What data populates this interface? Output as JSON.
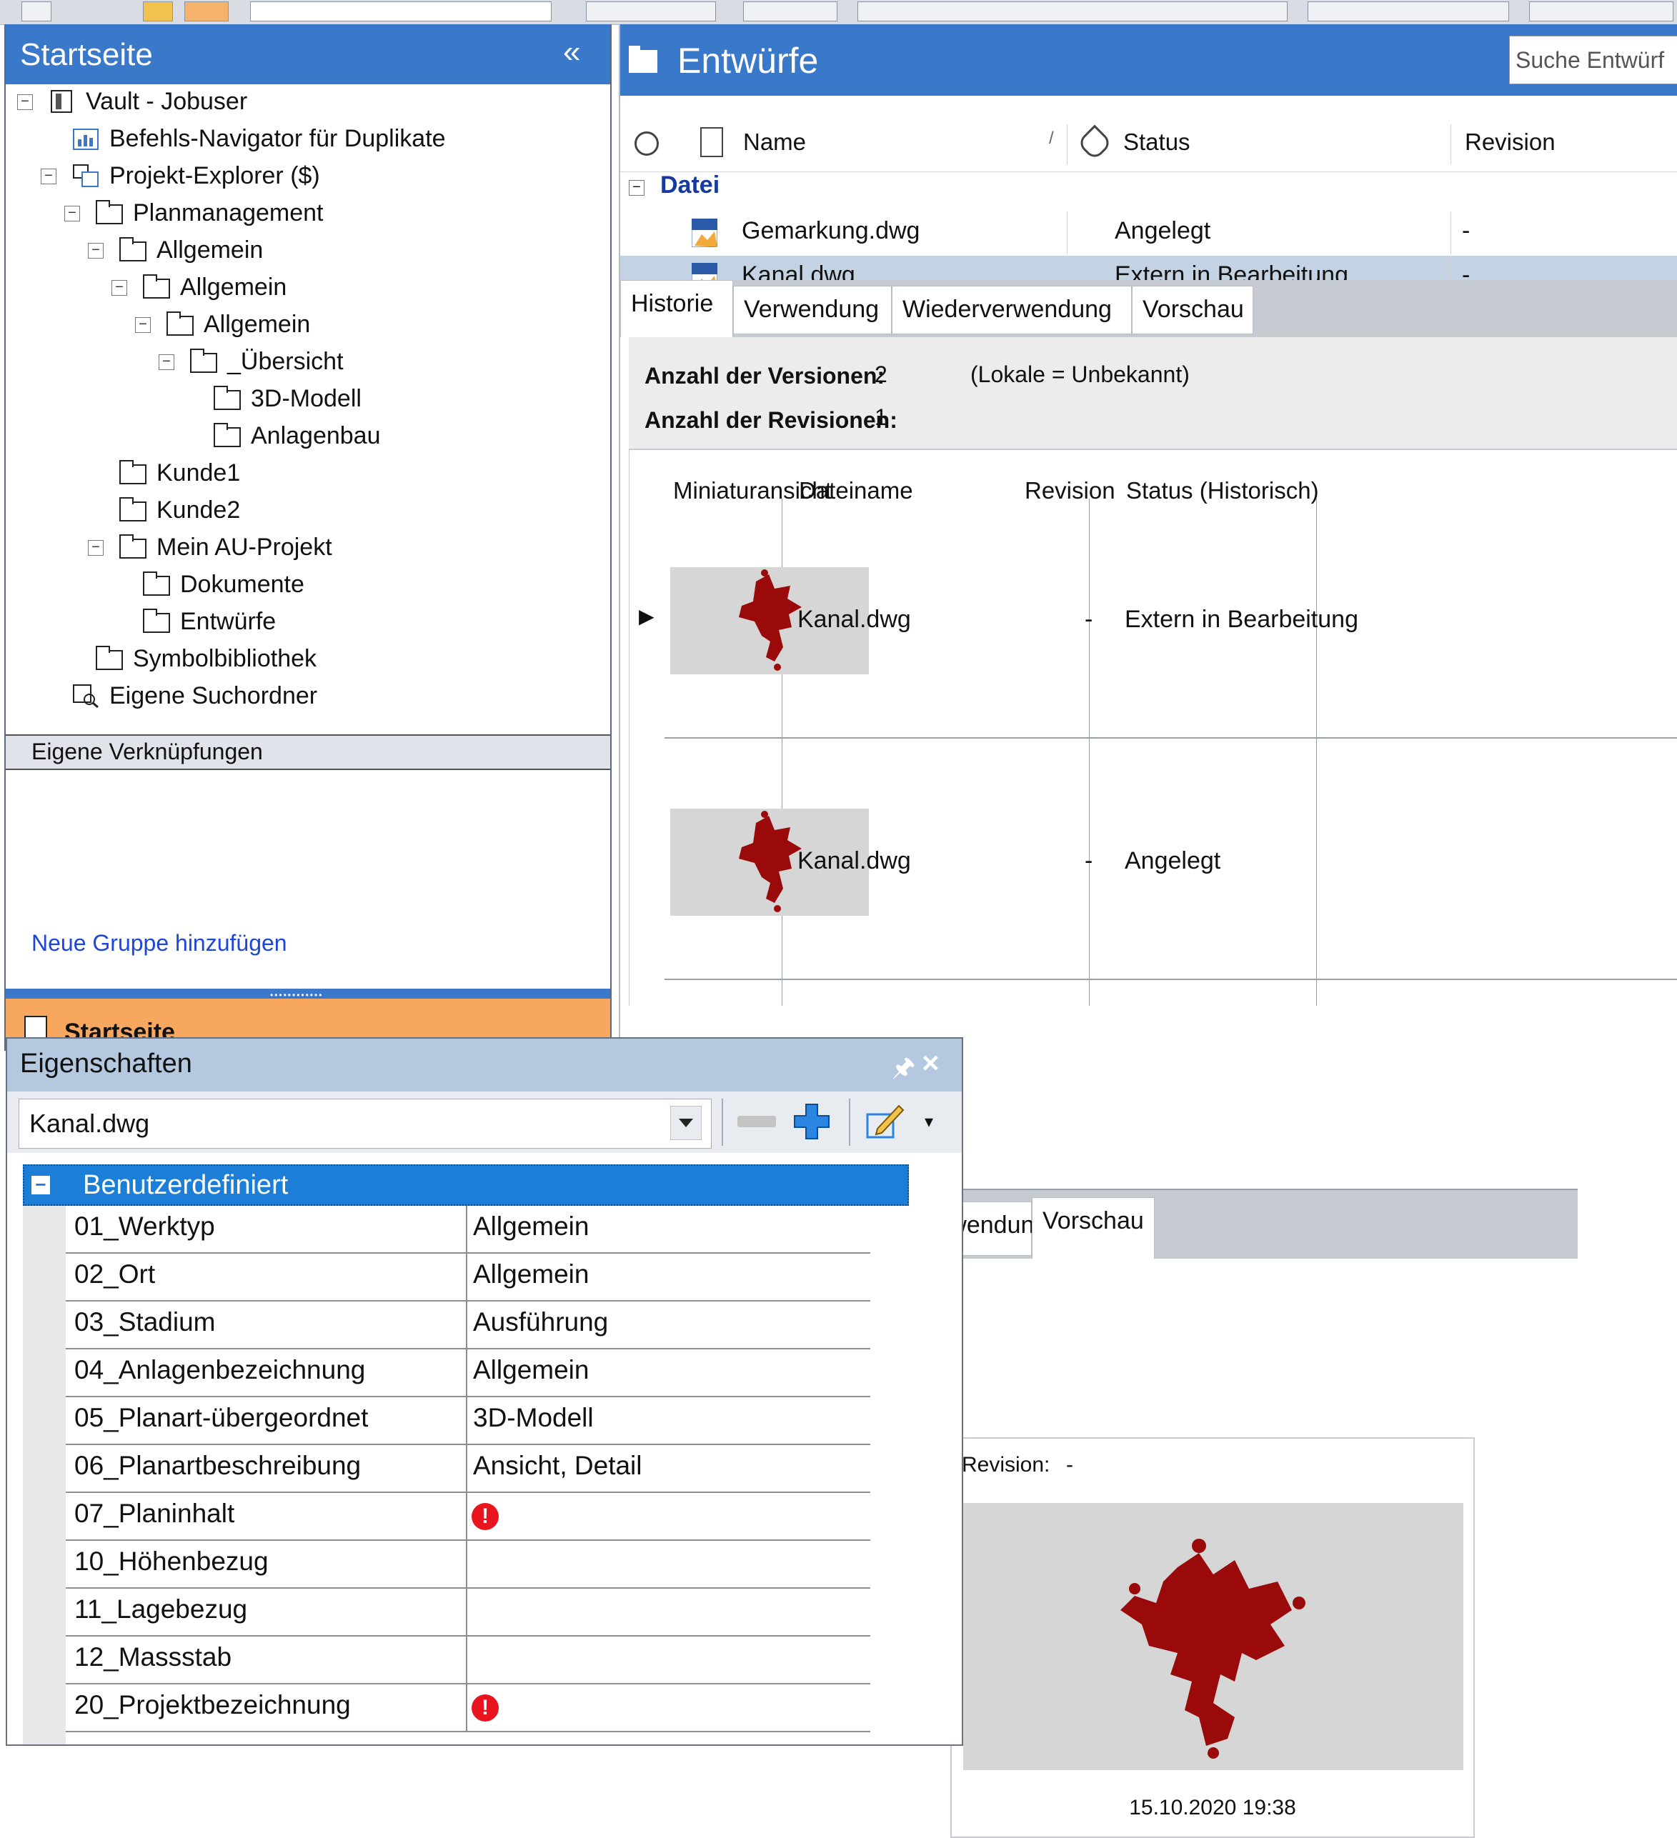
{
  "nav": {
    "title": "Startseite",
    "tree": [
      {
        "label": "Vault - Jobuser",
        "level": 0,
        "expander": "minus",
        "icon": "vault-icon"
      },
      {
        "label": "Befehls-Navigator für Duplikate",
        "level": 1,
        "expander": "",
        "icon": "chart-icon"
      },
      {
        "label": "Projekt-Explorer ($)",
        "level": 1,
        "expander": "minus",
        "icon": "project-explorer-icon"
      },
      {
        "label": "Planmanagement",
        "level": 2,
        "expander": "minus",
        "icon": "folder-icon"
      },
      {
        "label": "Allgemein",
        "level": 3,
        "expander": "minus",
        "icon": "folder-icon"
      },
      {
        "label": "Allgemein",
        "level": 4,
        "expander": "minus",
        "icon": "folder-icon"
      },
      {
        "label": "Allgemein",
        "level": 5,
        "expander": "minus",
        "icon": "folder-icon"
      },
      {
        "label": "_Übersicht",
        "level": 6,
        "expander": "minus",
        "icon": "folder-icon"
      },
      {
        "label": "3D-Modell",
        "level": 7,
        "expander": "",
        "icon": "folder-icon"
      },
      {
        "label": "Anlagenbau",
        "level": 7,
        "expander": "",
        "icon": "folder-icon"
      },
      {
        "label": "Kunde1",
        "level": 3,
        "expander": "",
        "icon": "folder-icon"
      },
      {
        "label": "Kunde2",
        "level": 3,
        "expander": "",
        "icon": "folder-icon"
      },
      {
        "label": "Mein AU-Projekt",
        "level": 3,
        "expander": "minus",
        "icon": "folder-icon"
      },
      {
        "label": "Dokumente",
        "level": 4,
        "expander": "",
        "icon": "folder-icon"
      },
      {
        "label": "Entwürfe",
        "level": 4,
        "expander": "",
        "icon": "folder-icon"
      },
      {
        "label": "Symbolbibliothek",
        "level": 2,
        "expander": "",
        "icon": "folder-icon"
      },
      {
        "label": "Eigene Suchordner",
        "level": 1,
        "expander": "",
        "icon": "search-folder-icon"
      }
    ],
    "links_header": "Eigene Verknüpfungen",
    "add_group": "Neue Gruppe hinzufügen",
    "start_button": "Startseite",
    "collapse_glyph": "«"
  },
  "main": {
    "title": "Entwürfe",
    "search_placeholder": "Suche Entwürf",
    "columns": {
      "name": "Name",
      "status": "Status",
      "revision": "Revision"
    },
    "group_label": "Datei",
    "files": [
      {
        "name": "Gemarkung.dwg",
        "status": "Angelegt",
        "revision": "-",
        "selected": false
      },
      {
        "name": "Kanal.dwg",
        "status": "Extern in Bearbeitung",
        "revision": "-",
        "selected": true
      }
    ],
    "tabs": [
      "Historie",
      "Verwendung",
      "Wiederverwendung",
      "Vorschau"
    ],
    "active_tab": "Historie",
    "summary": {
      "versions_label": "Anzahl der Versionen:",
      "versions_value": "2",
      "local_note": "(Lokale = Unbekannt)",
      "revisions_label": "Anzahl der Revisionen:",
      "revisions_value": "1"
    },
    "history_columns": {
      "thumbnail": "Miniaturansicht",
      "filename": "Dateiname",
      "revision": "Revision",
      "status": "Status (Historisch)"
    },
    "history": [
      {
        "filename": "Kanal.dwg",
        "revision": "-",
        "status": "Extern in Bearbeitung",
        "current": true
      },
      {
        "filename": "Kanal.dwg",
        "revision": "-",
        "status": "Angelegt",
        "current": false
      }
    ]
  },
  "properties": {
    "title": "Eigenschaften",
    "selected_file": "Kanal.dwg",
    "group": "Benutzerdefiniert",
    "rows": [
      {
        "name": "01_Werktyp",
        "value": "Allgemein",
        "error": false
      },
      {
        "name": "02_Ort",
        "value": "Allgemein",
        "error": false
      },
      {
        "name": "03_Stadium",
        "value": "Ausführung",
        "error": false
      },
      {
        "name": "04_Anlagenbezeichnung",
        "value": "Allgemein",
        "error": false
      },
      {
        "name": "05_Planart-übergeordnet",
        "value": "3D-Modell",
        "error": false
      },
      {
        "name": "06_Planartbeschreibung",
        "value": "Ansicht, Detail",
        "error": false
      },
      {
        "name": "07_Planinhalt",
        "value": "",
        "error": true
      },
      {
        "name": "10_Höhenbezug",
        "value": "",
        "error": false
      },
      {
        "name": "11_Lagebezug",
        "value": "",
        "error": false
      },
      {
        "name": "12_Massstab",
        "value": "",
        "error": false
      },
      {
        "name": "20_Projektbezeichnung",
        "value": "",
        "error": true
      }
    ]
  },
  "tabs2": [
    "ederverwendung",
    "Vorschau"
  ],
  "preview": {
    "revision_label": "Revision:",
    "revision_value": "-",
    "date": "15.10.2020 19:38"
  },
  "colors": {
    "header_blue": "#3a78c9",
    "selection_blue": "#1c7ed6",
    "map_red": "#9b0a0a",
    "error_red": "#e8141e",
    "start_orange": "#f8a75e"
  }
}
